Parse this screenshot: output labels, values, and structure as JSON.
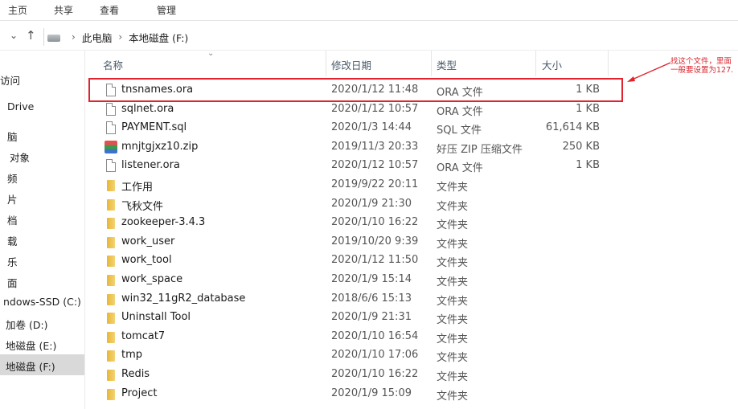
{
  "ribbon": {
    "tabs": [
      "主页",
      "共享",
      "查看",
      "管理"
    ]
  },
  "address": {
    "path": [
      "此电脑",
      "本地磁盘 (F:)"
    ]
  },
  "sidebar": {
    "items": [
      "访问",
      "Drive",
      "脑",
      "对象",
      "频",
      "片",
      "档",
      "载",
      "乐",
      "面",
      "ndows-SSD (C:)",
      "加卷 (D:)",
      "地磁盘 (E:)",
      "地磁盘 (F:)"
    ]
  },
  "columns": {
    "name": "名称",
    "date": "修改日期",
    "type": "类型",
    "size": "大小"
  },
  "files": [
    {
      "icon": "file",
      "name": "tnsnames.ora",
      "date": "2020/1/12 11:48",
      "type": "ORA 文件",
      "size": "1 KB"
    },
    {
      "icon": "file",
      "name": "sqlnet.ora",
      "date": "2020/1/12 10:57",
      "type": "ORA 文件",
      "size": "1 KB"
    },
    {
      "icon": "file",
      "name": "PAYMENT.sql",
      "date": "2020/1/3 14:44",
      "type": "SQL 文件",
      "size": "61,614 KB"
    },
    {
      "icon": "zip",
      "name": "mnjtgjxz10.zip",
      "date": "2019/11/3 20:33",
      "type": "好压 ZIP 压缩文件",
      "size": "250 KB"
    },
    {
      "icon": "file",
      "name": "listener.ora",
      "date": "2020/1/12 10:57",
      "type": "ORA 文件",
      "size": "1 KB"
    },
    {
      "icon": "folder",
      "name": "工作用",
      "date": "2019/9/22 20:11",
      "type": "文件夹",
      "size": ""
    },
    {
      "icon": "folder",
      "name": "飞秋文件",
      "date": "2020/1/9 21:30",
      "type": "文件夹",
      "size": ""
    },
    {
      "icon": "folder",
      "name": "zookeeper-3.4.3",
      "date": "2020/1/10 16:22",
      "type": "文件夹",
      "size": ""
    },
    {
      "icon": "folder",
      "name": "work_user",
      "date": "2019/10/20 9:39",
      "type": "文件夹",
      "size": ""
    },
    {
      "icon": "folder",
      "name": "work_tool",
      "date": "2020/1/12 11:50",
      "type": "文件夹",
      "size": ""
    },
    {
      "icon": "folder",
      "name": "work_space",
      "date": "2020/1/9 15:14",
      "type": "文件夹",
      "size": ""
    },
    {
      "icon": "folder",
      "name": "win32_11gR2_database",
      "date": "2018/6/6 15:13",
      "type": "文件夹",
      "size": ""
    },
    {
      "icon": "folder",
      "name": "Uninstall Tool",
      "date": "2020/1/9 21:31",
      "type": "文件夹",
      "size": ""
    },
    {
      "icon": "folder",
      "name": "tomcat7",
      "date": "2020/1/10 16:54",
      "type": "文件夹",
      "size": ""
    },
    {
      "icon": "folder",
      "name": "tmp",
      "date": "2020/1/10 17:06",
      "type": "文件夹",
      "size": ""
    },
    {
      "icon": "folder",
      "name": "Redis",
      "date": "2020/1/10 16:22",
      "type": "文件夹",
      "size": ""
    },
    {
      "icon": "folder",
      "name": "Project",
      "date": "2020/1/9 15:09",
      "type": "文件夹",
      "size": ""
    }
  ],
  "annotation": {
    "lines": [
      "找这个文件，里面",
      "一般要设置为127."
    ],
    "color": "#e0232e"
  }
}
